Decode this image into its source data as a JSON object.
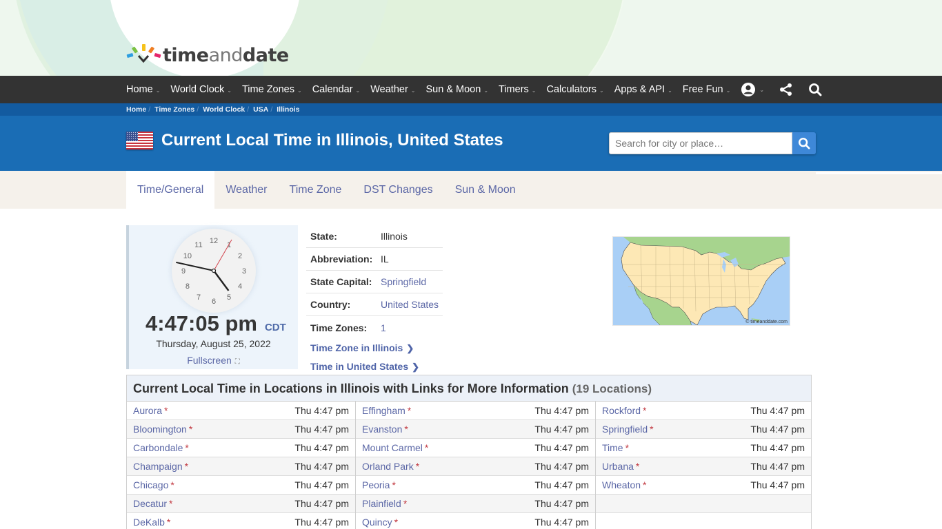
{
  "logo": {
    "text_time": "time",
    "text_and": "and",
    "text_date": "date"
  },
  "nav": {
    "items": [
      {
        "label": "Home"
      },
      {
        "label": "World Clock"
      },
      {
        "label": "Time Zones"
      },
      {
        "label": "Calendar"
      },
      {
        "label": "Weather"
      },
      {
        "label": "Sun & Moon"
      },
      {
        "label": "Timers"
      },
      {
        "label": "Calculators"
      },
      {
        "label": "Apps & API"
      },
      {
        "label": "Free Fun"
      }
    ],
    "icons": [
      "account-icon",
      "share-icon",
      "search-icon"
    ]
  },
  "breadcrumb": [
    "Home",
    "Time Zones",
    "World Clock",
    "USA",
    "Illinois"
  ],
  "header": {
    "title": "Current Local Time in Illinois, United States",
    "search_placeholder": "Search for city or place…"
  },
  "tabs": [
    {
      "label": "Time/General",
      "active": true
    },
    {
      "label": "Weather"
    },
    {
      "label": "Time Zone"
    },
    {
      "label": "DST Changes"
    },
    {
      "label": "Sun & Moon"
    }
  ],
  "clock": {
    "numerals": [
      "12",
      "1",
      "2",
      "3",
      "4",
      "5",
      "6",
      "7",
      "8",
      "9",
      "10",
      "11"
    ],
    "hours": 4,
    "minutes": 47,
    "seconds": 5,
    "time": "4:47:05 pm",
    "tz": "CDT",
    "date": "Thursday, August 25, 2022",
    "fullscreen_label": "Fullscreen",
    "second_hand_color": "#d2434c"
  },
  "info": {
    "rows": [
      {
        "key": "State:",
        "value": "Illinois",
        "link": false
      },
      {
        "key": "Abbreviation:",
        "value": "IL",
        "link": false
      },
      {
        "key": "State Capital:",
        "value": "Springfield",
        "link": true
      },
      {
        "key": "Country:",
        "value": "United States",
        "link": true
      },
      {
        "key": "Time Zones:",
        "value": "1",
        "link": true
      }
    ],
    "links": [
      "Time Zone in Illinois",
      "Time in United States"
    ]
  },
  "map": {
    "copyright": "© timeanddate.com"
  },
  "locations": {
    "title": "Current Local Time in Locations in Illinois with Links for More Information",
    "count": "(19 Locations)",
    "columns": [
      [
        {
          "city": "Aurora",
          "time": "Thu 4:47 pm"
        },
        {
          "city": "Bloomington",
          "time": "Thu 4:47 pm"
        },
        {
          "city": "Carbondale",
          "time": "Thu 4:47 pm"
        },
        {
          "city": "Champaign",
          "time": "Thu 4:47 pm"
        },
        {
          "city": "Chicago",
          "time": "Thu 4:47 pm"
        },
        {
          "city": "Decatur",
          "time": "Thu 4:47 pm"
        },
        {
          "city": "DeKalb",
          "time": "Thu 4:47 pm"
        }
      ],
      [
        {
          "city": "Effingham",
          "time": "Thu 4:47 pm"
        },
        {
          "city": "Evanston",
          "time": "Thu 4:47 pm"
        },
        {
          "city": "Mount Carmel",
          "time": "Thu 4:47 pm"
        },
        {
          "city": "Orland Park",
          "time": "Thu 4:47 pm"
        },
        {
          "city": "Peoria",
          "time": "Thu 4:47 pm"
        },
        {
          "city": "Plainfield",
          "time": "Thu 4:47 pm"
        },
        {
          "city": "Quincy",
          "time": "Thu 4:47 pm"
        }
      ],
      [
        {
          "city": "Rockford",
          "time": "Thu 4:47 pm"
        },
        {
          "city": "Springfield",
          "time": "Thu 4:47 pm"
        },
        {
          "city": "Time",
          "time": "Thu 4:47 pm"
        },
        {
          "city": "Urbana",
          "time": "Thu 4:47 pm"
        },
        {
          "city": "Wheaton",
          "time": "Thu 4:47 pm"
        },
        {
          "city": "",
          "time": ""
        },
        {
          "city": "",
          "time": ""
        }
      ]
    ],
    "dst_marker": "*"
  }
}
